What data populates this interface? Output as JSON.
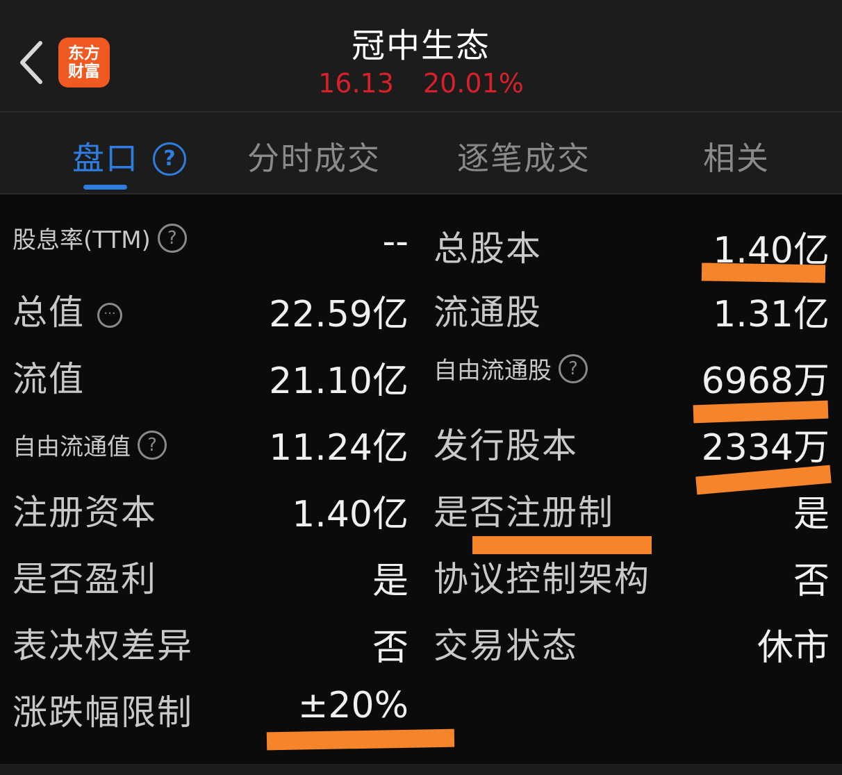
{
  "header": {
    "logo_line1": "东方",
    "logo_line2": "财富",
    "stock_name": "冠中生态",
    "price": "16.13",
    "change_pct": "20.01%",
    "price_color": "#d8202a",
    "logo_color": "#f05a22"
  },
  "tabs": [
    {
      "label": "盘口",
      "active": true
    },
    {
      "label": "分时成交"
    },
    {
      "label": "逐笔成交"
    },
    {
      "label": "相关"
    }
  ],
  "tab_help_glyph": "?",
  "accent_color": "#2f7de0",
  "highlight_color": "#f5842a",
  "left_rows": [
    {
      "label": "股息率(TTM)",
      "value": "--",
      "icon": "question-circle-icon"
    },
    {
      "label": "总值",
      "value": "22.59亿",
      "icon": "more-circle-icon"
    },
    {
      "label": "流值",
      "value": "21.10亿"
    },
    {
      "label": "自由流通值",
      "value": "11.24亿",
      "icon": "question-circle-icon"
    },
    {
      "label": "注册资本",
      "value": "1.40亿"
    },
    {
      "label": "是否盈利",
      "value": "是"
    },
    {
      "label": "表决权差异",
      "value": "否"
    },
    {
      "label": "涨跌幅限制",
      "value": "±20%"
    }
  ],
  "right_rows": [
    {
      "label": "总股本",
      "value": "1.40亿"
    },
    {
      "label": "流通股",
      "value": "1.31亿"
    },
    {
      "label": "自由流通股",
      "value": "6968万",
      "icon": "question-circle-icon"
    },
    {
      "label": "发行股本",
      "value": "2334万"
    },
    {
      "label": "是否注册制",
      "value": "是"
    },
    {
      "label": "协议控制架构",
      "value": "否"
    },
    {
      "label": "交易状态",
      "value": "休市"
    }
  ],
  "help_glyph": "?",
  "more_glyph": "···"
}
